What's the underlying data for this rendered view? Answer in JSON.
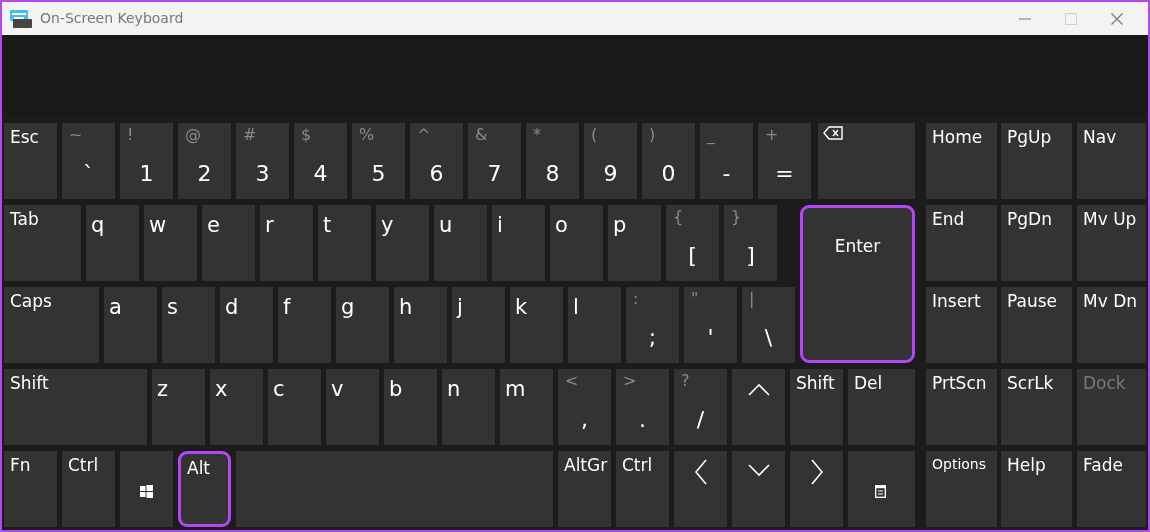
{
  "window": {
    "title": "On-Screen Keyboard",
    "buttons": [
      {
        "kind": "minimize",
        "disabled": false
      },
      {
        "kind": "maximize",
        "disabled": true
      },
      {
        "kind": "close",
        "disabled": false
      }
    ]
  },
  "keyboard": {
    "rows": [
      [
        {
          "kind": "label",
          "label": "Esc",
          "highlighted": false
        },
        {
          "kind": "dual",
          "shift": "~",
          "label": "`",
          "highlighted": false
        },
        {
          "kind": "dual",
          "shift": "!",
          "label": "1",
          "highlighted": false
        },
        {
          "kind": "dual",
          "shift": "@",
          "label": "2",
          "highlighted": false
        },
        {
          "kind": "dual",
          "shift": "#",
          "label": "3",
          "highlighted": false
        },
        {
          "kind": "dual",
          "shift": "$",
          "label": "4",
          "highlighted": false
        },
        {
          "kind": "dual",
          "shift": "%",
          "label": "5",
          "highlighted": false
        },
        {
          "kind": "dual",
          "shift": "^",
          "label": "6",
          "highlighted": false
        },
        {
          "kind": "dual",
          "shift": "&",
          "label": "7",
          "highlighted": false
        },
        {
          "kind": "dual",
          "shift": "*",
          "label": "8",
          "highlighted": false
        },
        {
          "kind": "dual",
          "shift": "(",
          "label": "9",
          "highlighted": false
        },
        {
          "kind": "dual",
          "shift": ")",
          "label": "0",
          "highlighted": false
        },
        {
          "kind": "dual",
          "shift": "_",
          "label": "-",
          "highlighted": false
        },
        {
          "kind": "dual",
          "shift": "+",
          "label": "=",
          "highlighted": false
        },
        {
          "kind": "backspace",
          "highlighted": false
        }
      ],
      [
        {
          "kind": "label",
          "label": "Tab",
          "highlighted": false
        },
        {
          "kind": "letter",
          "label": "q",
          "highlighted": false
        },
        {
          "kind": "letter",
          "label": "w",
          "highlighted": false
        },
        {
          "kind": "letter",
          "label": "e",
          "highlighted": false
        },
        {
          "kind": "letter",
          "label": "r",
          "highlighted": false
        },
        {
          "kind": "letter",
          "label": "t",
          "highlighted": false
        },
        {
          "kind": "letter",
          "label": "y",
          "highlighted": false
        },
        {
          "kind": "letter",
          "label": "u",
          "highlighted": false
        },
        {
          "kind": "letter",
          "label": "i",
          "highlighted": false
        },
        {
          "kind": "letter",
          "label": "o",
          "highlighted": false
        },
        {
          "kind": "letter",
          "label": "p",
          "highlighted": false
        },
        {
          "kind": "dual",
          "shift": "{",
          "label": "[",
          "highlighted": false
        },
        {
          "kind": "dual",
          "shift": "}",
          "label": "]",
          "highlighted": false
        },
        {
          "kind": "enter",
          "label": "Enter",
          "highlighted": true
        }
      ],
      [
        {
          "kind": "label",
          "label": "Caps",
          "highlighted": false
        },
        {
          "kind": "letter",
          "label": "a",
          "highlighted": false
        },
        {
          "kind": "letter",
          "label": "s",
          "highlighted": false
        },
        {
          "kind": "letter",
          "label": "d",
          "highlighted": false
        },
        {
          "kind": "letter",
          "label": "f",
          "highlighted": false
        },
        {
          "kind": "letter",
          "label": "g",
          "highlighted": false
        },
        {
          "kind": "letter",
          "label": "h",
          "highlighted": false
        },
        {
          "kind": "letter",
          "label": "j",
          "highlighted": false
        },
        {
          "kind": "letter",
          "label": "k",
          "highlighted": false
        },
        {
          "kind": "letter",
          "label": "l",
          "highlighted": false
        },
        {
          "kind": "dual",
          "shift": ":",
          "label": ";",
          "highlighted": false
        },
        {
          "kind": "dual",
          "shift": "\"",
          "label": "'",
          "highlighted": false
        },
        {
          "kind": "dual",
          "shift": "|",
          "label": "\\",
          "highlighted": false
        }
      ],
      [
        {
          "kind": "label",
          "label": "Shift",
          "highlighted": false
        },
        {
          "kind": "letter",
          "label": "z",
          "highlighted": false
        },
        {
          "kind": "letter",
          "label": "x",
          "highlighted": false
        },
        {
          "kind": "letter",
          "label": "c",
          "highlighted": false
        },
        {
          "kind": "letter",
          "label": "v",
          "highlighted": false
        },
        {
          "kind": "letter",
          "label": "b",
          "highlighted": false
        },
        {
          "kind": "letter",
          "label": "n",
          "highlighted": false
        },
        {
          "kind": "letter",
          "label": "m",
          "highlighted": false
        },
        {
          "kind": "dual",
          "shift": "<",
          "label": ",",
          "highlighted": false
        },
        {
          "kind": "dual",
          "shift": ">",
          "label": ".",
          "highlighted": false
        },
        {
          "kind": "dual",
          "shift": "?",
          "label": "/",
          "highlighted": false
        },
        {
          "kind": "up",
          "highlighted": false
        },
        {
          "kind": "label",
          "label": "Shift",
          "highlighted": false
        },
        {
          "kind": "label",
          "label": "Del",
          "highlighted": false
        }
      ],
      [
        {
          "kind": "label",
          "label": "Fn",
          "highlighted": false
        },
        {
          "kind": "label",
          "label": "Ctrl",
          "highlighted": false
        },
        {
          "kind": "windows",
          "highlighted": false
        },
        {
          "kind": "label",
          "label": "Alt",
          "highlighted": true
        },
        {
          "kind": "space",
          "highlighted": false
        },
        {
          "kind": "label",
          "label": "AltGr",
          "highlighted": false
        },
        {
          "kind": "label",
          "label": "Ctrl",
          "highlighted": false
        },
        {
          "kind": "left",
          "highlighted": false
        },
        {
          "kind": "down",
          "highlighted": false
        },
        {
          "kind": "right",
          "highlighted": false
        },
        {
          "kind": "menu",
          "highlighted": false
        }
      ]
    ]
  },
  "nav_keys": [
    [
      {
        "label": "Home",
        "disabled": false
      },
      {
        "label": "PgUp",
        "disabled": false
      },
      {
        "label": "Nav",
        "disabled": false
      }
    ],
    [
      {
        "label": "End",
        "disabled": false
      },
      {
        "label": "PgDn",
        "disabled": false
      },
      {
        "label": "Mv Up",
        "disabled": false
      }
    ],
    [
      {
        "label": "Insert",
        "disabled": false
      },
      {
        "label": "Pause",
        "disabled": false
      },
      {
        "label": "Mv Dn",
        "disabled": false
      }
    ],
    [
      {
        "label": "PrtScn",
        "disabled": false
      },
      {
        "label": "ScrLk",
        "disabled": false
      },
      {
        "label": "Dock",
        "disabled": true
      }
    ],
    [
      {
        "label": "Options",
        "disabled": false
      },
      {
        "label": "Help",
        "disabled": false
      },
      {
        "label": "Fade",
        "disabled": false
      }
    ]
  ]
}
